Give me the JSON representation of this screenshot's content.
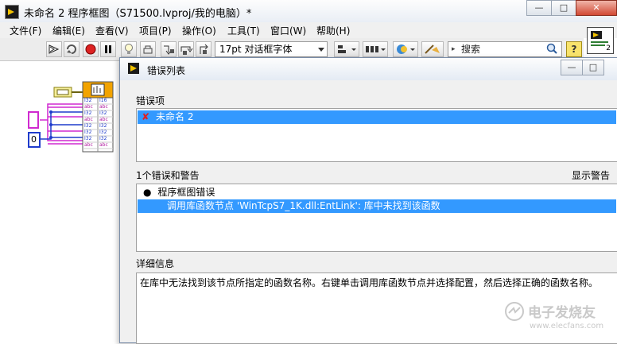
{
  "window": {
    "title": "未命名 2 程序框图（S71500.lvproj/我的电脑）*",
    "minimize": "—",
    "maximize": "□",
    "close": "✕"
  },
  "menu": [
    "文件(F)",
    "编辑(E)",
    "查看(V)",
    "项目(P)",
    "操作(O)",
    "工具(T)",
    "窗口(W)",
    "帮助(H)"
  ],
  "toolbar": {
    "font": "17pt 对话框字体",
    "search_placeholder": "搜索",
    "help": "?"
  },
  "vi_icon": {
    "number": "2"
  },
  "diagram": {
    "constant_value": "0",
    "row_labels": [
      "abc",
      "I32",
      "abc",
      "I32",
      "I32",
      "I32",
      "abc"
    ],
    "col_labels": [
      "I32",
      "I16"
    ]
  },
  "dialog": {
    "title": "错误列表",
    "error_items_label": "错误项",
    "error_items": [
      {
        "icon": "✘",
        "name": "未命名 2"
      }
    ],
    "errors_warnings_label": "1个错误和警告",
    "show_warnings": "显示警告",
    "group": "程序框图错误",
    "error_message": "调用库函数节点 'WinTcpS7_1K.dll:EntLink': 库中未找到该函数",
    "details_label": "详细信息",
    "details_text": "在库中无法找到该节点所指定的函数名称。右键单击调用库函数节点并选择配置，然后选择正确的函数名称。"
  },
  "watermark": {
    "brand": "电子发烧友",
    "url": "www.elecfans.com"
  },
  "colors": {
    "selection": "#3399ff",
    "string_wire": "#d02ad0",
    "numeric_wire": "#1f3ccc",
    "node_header": "#f2a300"
  }
}
